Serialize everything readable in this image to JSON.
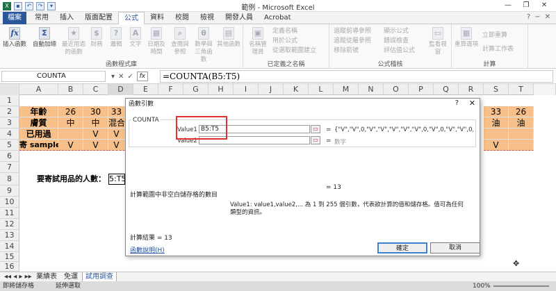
{
  "window": {
    "title": "範例 - Microsoft Excel",
    "minimize": "—",
    "restore": "❐",
    "close": "✕"
  },
  "ribbon_tabs": {
    "file": "檔案",
    "tabs": [
      "常用",
      "插入",
      "版面配置",
      "公式",
      "資料",
      "校閱",
      "檢視",
      "開發人員",
      "Acrobat"
    ],
    "active": "公式"
  },
  "ribbon": {
    "group1_label": "函數程式庫",
    "insert_function": "插入函數",
    "autosum": "自動加總",
    "recent": "最近用過的函數",
    "financial": "財務",
    "logical": "邏輯",
    "text": "文字",
    "datetime": "日期及時間",
    "lookup": "查閱與參照",
    "math": "數學與三角函數",
    "more": "其他函數",
    "group2_label": "已定義之名稱",
    "name_manager": "名稱管理員",
    "define_name": "定義名稱",
    "use_in_formula": "用於公式",
    "create_from_sel": "從選取範圍建立",
    "group3_label": "公式稽核",
    "trace_precedents": "追蹤前導參照",
    "trace_dependents": "追蹤從屬參照",
    "remove_arrows": "移除箭號",
    "show_formulas": "顯示公式",
    "error_checking": "錯誤檢查",
    "evaluate_formula": "評估值公式",
    "watch_window": "監看視窗",
    "group4_label": "計算",
    "calc_options": "重算選項",
    "calc_now": "立即重算",
    "calc_sheet": "計算工作表"
  },
  "formula_bar": {
    "name_box": "COUNTA",
    "formula": "=COUNTA(B5:T5)"
  },
  "columns": [
    "A",
    "B",
    "C",
    "D",
    "E",
    "F",
    "G",
    "H",
    "I",
    "J",
    "K",
    "L",
    "M",
    "N",
    "O",
    "P",
    "Q",
    "R",
    "S",
    "T"
  ],
  "rows": [
    "1",
    "2",
    "3",
    "4",
    "5",
    "6",
    "7",
    "8",
    "9",
    "10",
    "11",
    "12",
    "13",
    "14",
    "15",
    "16"
  ],
  "cells": {
    "a2": "年齡",
    "a3": "膚質",
    "a4": "已用過",
    "a5": "寄 sample",
    "b2": "26",
    "c2": "30",
    "d2": "33",
    "s2": "33",
    "t2": "26",
    "b3": "中",
    "c3": "中",
    "d3": "混合",
    "s3": "油",
    "t3": "油",
    "c4": "V",
    "d4": "V",
    "b5": "V",
    "c5": "V",
    "d5": "V",
    "s5": "V",
    "a8": "要寄試用品的人數：",
    "d8": "5:T5)"
  },
  "dialog": {
    "title": "函數引數",
    "help": "?",
    "close": "✕",
    "func_name": "COUNTA",
    "arg1_label": "Value1",
    "arg1_value": "B5:T5",
    "arg1_result": "{\"V\",\"V\",0,\"V\",\"V\",\"V\",\"V\",\"V\",0,\"V\",0,\"V\",\"V\",0,\"\\",
    "arg2_label": "Value2",
    "arg2_result": "數字",
    "equals": "=",
    "result_inline": "= 13",
    "description": "計算範圍中非空白儲存格的數目",
    "arg_desc": "Value1:   value1,value2,... 為 1 到 255 個引數，代表欲計算的值和儲存格。值可為任何類型的資訊。",
    "calc_result": "計算結果 =    13",
    "help_link": "函數說明(H)",
    "ok": "確定",
    "cancel": "取消"
  },
  "sheet_tabs": [
    "業績表",
    "免運",
    "試用調查"
  ],
  "status": {
    "mode": "即將儲存格",
    "macro": "延伸選取",
    "zoom": "100%"
  }
}
